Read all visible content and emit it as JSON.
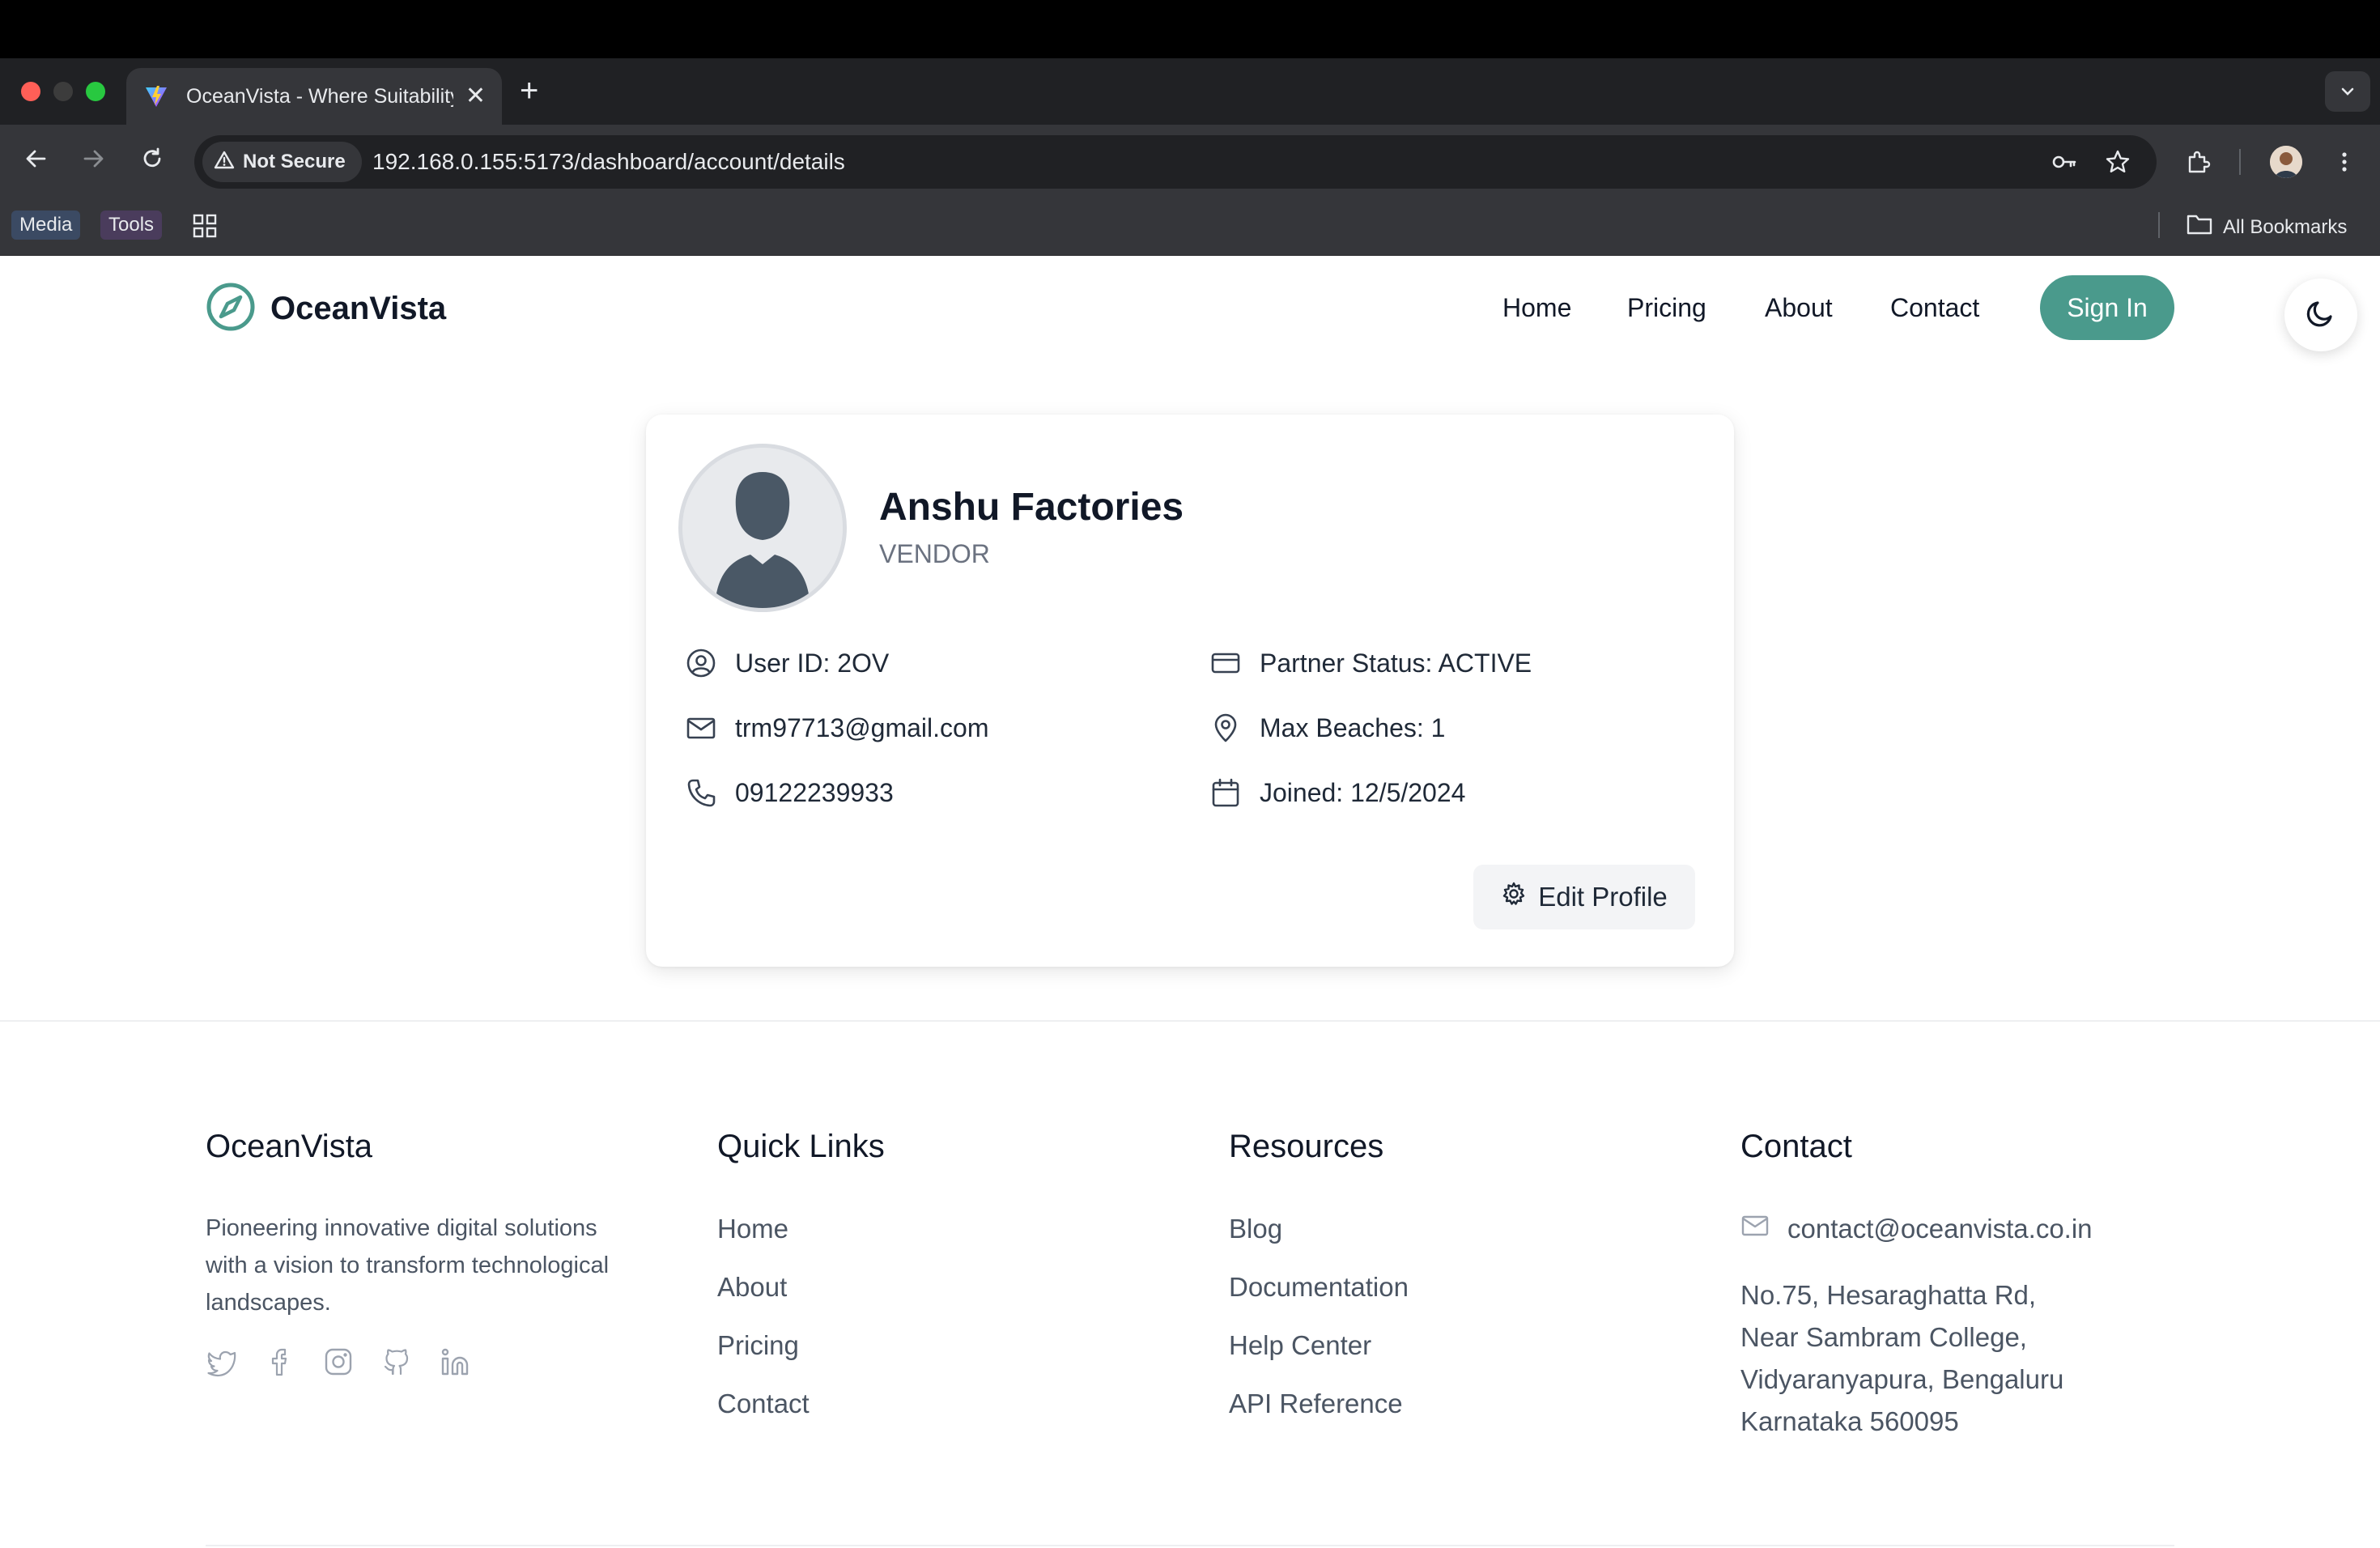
{
  "browser": {
    "tab_title": "OceanVista - Where Suitability",
    "tab_close": "✕",
    "new_tab": "+",
    "not_secure": "Not Secure",
    "url": "192.168.0.155:5173/dashboard/account/details",
    "bookmarks": [
      "Media",
      "Tools"
    ],
    "all_bookmarks": "All Bookmarks"
  },
  "site": {
    "logo_text": "OceanVista",
    "nav": [
      "Home",
      "Pricing",
      "About",
      "Contact"
    ],
    "sign_in": "Sign In"
  },
  "profile": {
    "name": "Anshu Factories",
    "role": "VENDOR",
    "user_id": "User ID: 2OV",
    "email": "trm97713@gmail.com",
    "phone": "09122239933",
    "partner_status": "Partner Status: ACTIVE",
    "max_beaches": "Max Beaches: 1",
    "joined": "Joined: 12/5/2024",
    "edit_button": "Edit Profile"
  },
  "footer": {
    "brand": {
      "title": "OceanVista",
      "description": "Pioneering innovative digital solutions with a vision to transform technological landscapes."
    },
    "social_icons": [
      "twitter-icon",
      "facebook-icon",
      "instagram-icon",
      "github-icon",
      "linkedin-icon"
    ],
    "quick_links": {
      "title": "Quick Links",
      "items": [
        "Home",
        "About",
        "Pricing",
        "Contact"
      ]
    },
    "resources": {
      "title": "Resources",
      "items": [
        "Blog",
        "Documentation",
        "Help Center",
        "API Reference"
      ]
    },
    "contact": {
      "title": "Contact",
      "email": "contact@oceanvista.co.in",
      "address": [
        "No.75, Hesaraghatta Rd,",
        "Near Sambram College,",
        "Vidyaranyapura, Bengaluru",
        "Karnataka 560095"
      ]
    }
  },
  "colors": {
    "accent": "#4a9a8c",
    "text": "#111827",
    "muted": "#4b5563"
  }
}
